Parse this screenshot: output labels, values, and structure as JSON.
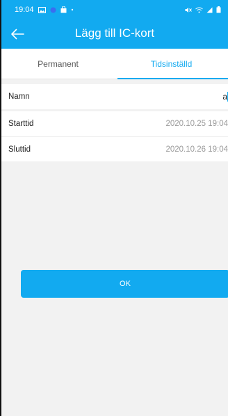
{
  "status_bar": {
    "time": "19:04",
    "icons_left": [
      "image-icon",
      "app-badge-icon",
      "shopping-bag-icon",
      "dot-icon"
    ],
    "icons_right": [
      "mute-icon",
      "wifi-icon",
      "signal-icon",
      "battery-icon"
    ]
  },
  "header": {
    "title": "Lägg till IC-kort",
    "back_icon": "arrow-left-icon"
  },
  "tabs": [
    {
      "label": "Permanent",
      "active": false
    },
    {
      "label": "Tidsinställd",
      "active": true
    }
  ],
  "form": {
    "name_label": "Namn",
    "name_value": "a",
    "start_label": "Starttid",
    "start_value": "2020.10.25 19:04",
    "end_label": "Sluttid",
    "end_value": "2020.10.26 19:04"
  },
  "actions": {
    "ok_label": "OK"
  },
  "colors": {
    "accent": "#12aaf0",
    "background": "#f2f2f2"
  }
}
